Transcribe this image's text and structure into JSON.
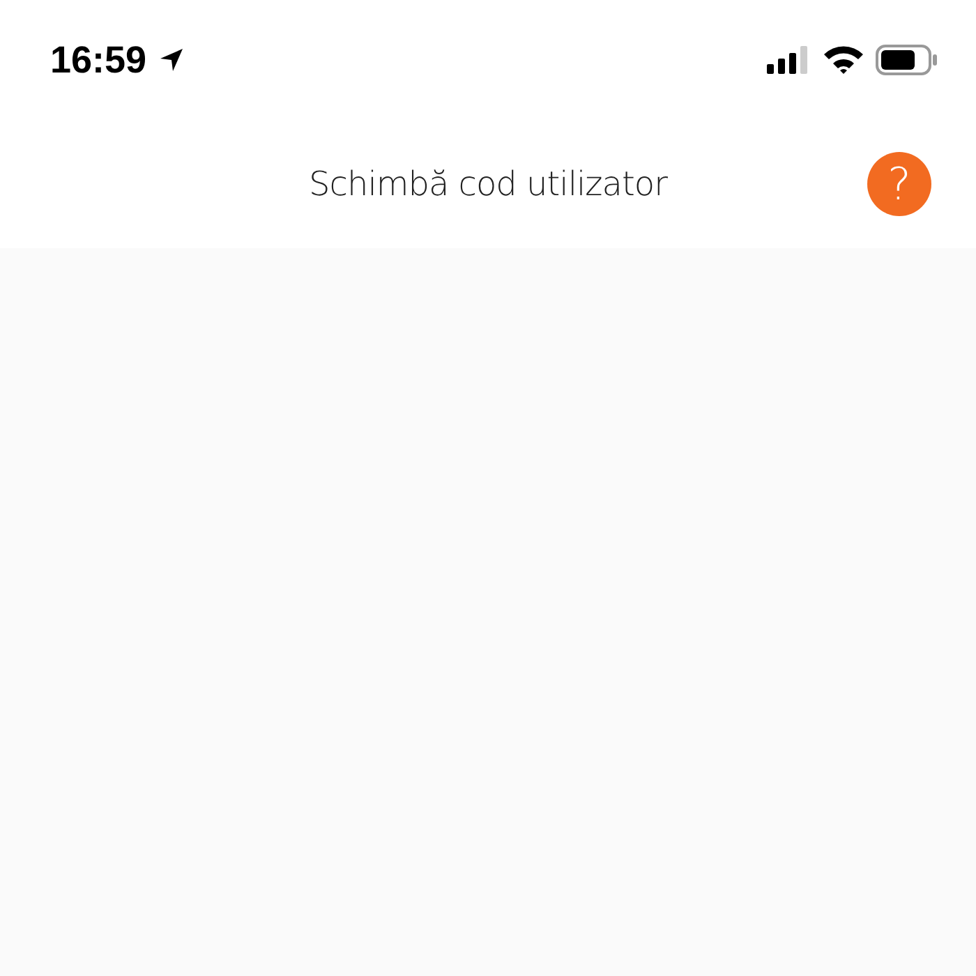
{
  "status_bar": {
    "time": "16:59"
  },
  "nav_bar": {
    "title": "Schimbă cod utilizator",
    "help_button": "?"
  }
}
